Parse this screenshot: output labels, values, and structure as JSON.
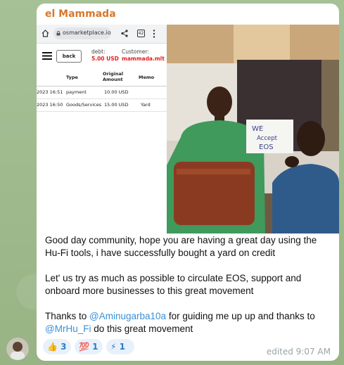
{
  "message": {
    "sender": "el Mammada",
    "paragraphs": [
      [
        "Good day community, hope you are having a great day using the Hu-Fi tools, i  have successfully bought  a yard on credit"
      ],
      [
        "Let' us try as much as possible to circulate EOS, support and onboard more businesses to this great movement"
      ]
    ],
    "thanks": {
      "prefix": "Thanks to ",
      "mention1": "@Aminugarba10a",
      "middle": " for guiding me up up and thanks to ",
      "mention2": "@MrHu_Fi",
      "suffix": " do this great movement"
    },
    "time": "edited 9:07 AM"
  },
  "reactions": [
    {
      "icon": "thumbs-up-icon",
      "emoji": "👍",
      "count": "3"
    },
    {
      "icon": "hundred-icon",
      "emoji": "💯",
      "count": "1"
    },
    {
      "icon": "lightning-icon",
      "emoji": "⚡",
      "count": "1"
    }
  ],
  "screenshot": {
    "url": "osmarketplace.io",
    "tab_count": "42",
    "back_label": "back",
    "debt_label": "debt:",
    "debt_value": "5.00 USD",
    "customer_label": "Customer:",
    "customer_value": "mammada.mlt",
    "headers": {
      "type": "Type",
      "original": "Original Amount",
      "memo": "Memo"
    },
    "rows": [
      {
        "date": "2023 16:51",
        "type": "payment",
        "amount": "10.00 USD",
        "memo": ""
      },
      {
        "date": "2023 16:50",
        "type": "Goods/Services",
        "amount": "15.00 USD",
        "memo": "Yard"
      }
    ]
  },
  "photo": {
    "sign_text": "WE Accept EOS"
  },
  "colors": {
    "sender": "#d7782a",
    "mention": "#3a8fd6",
    "reaction_bg": "#e8f1fb",
    "timestamp": "#9aa3a8"
  }
}
